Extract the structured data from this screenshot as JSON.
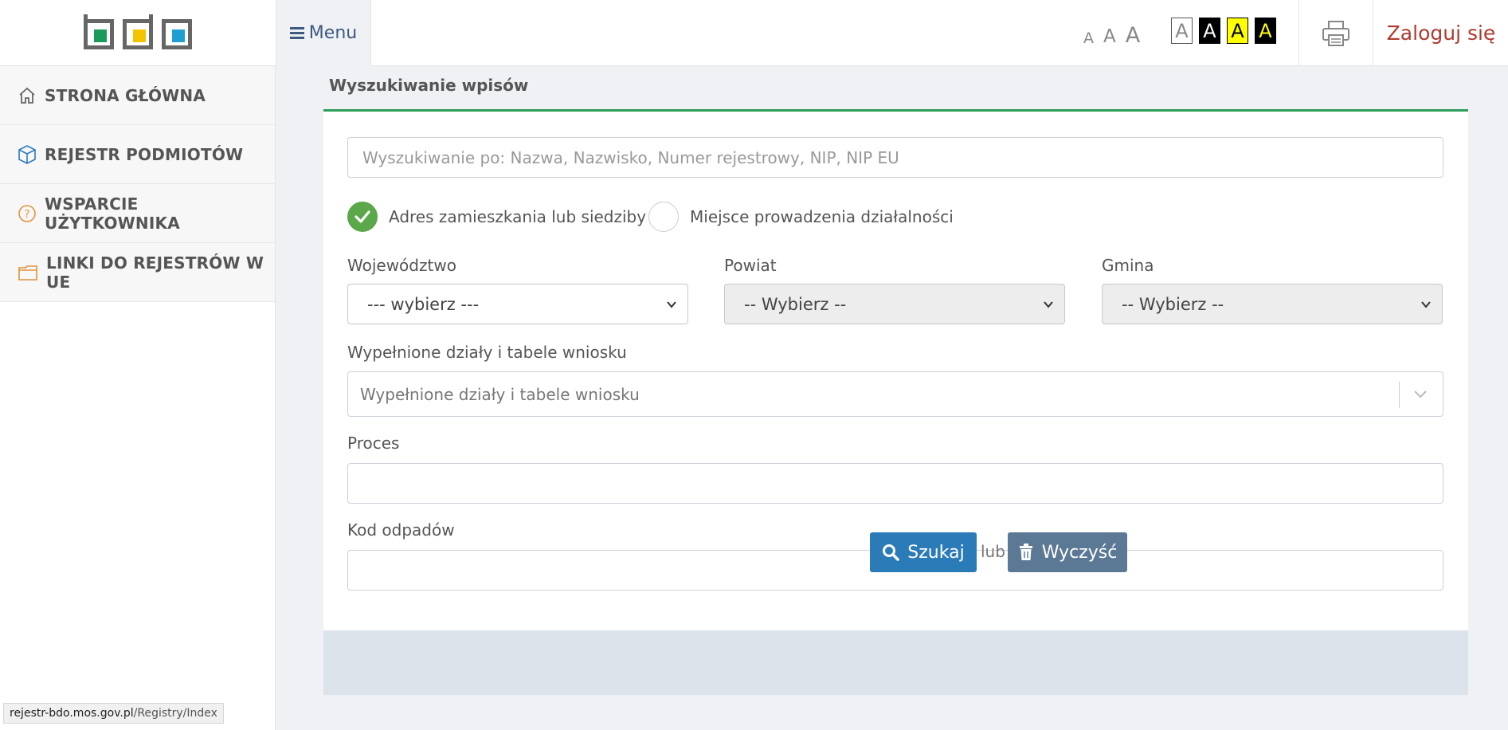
{
  "header": {
    "menu_label": "Menu",
    "font_size_small": "A",
    "font_size_medium": "A",
    "font_size_large": "A",
    "contrast_options": [
      {
        "label": "A",
        "bg": "#ffffff",
        "fg": "#888888",
        "border": "#555555"
      },
      {
        "label": "A",
        "bg": "#000000",
        "fg": "#ffffff",
        "border": "#000000"
      },
      {
        "label": "A",
        "bg": "#ffff00",
        "fg": "#000000",
        "border": "#000000"
      },
      {
        "label": "A",
        "bg": "#000000",
        "fg": "#ffff00",
        "border": "#000000"
      }
    ],
    "login_label": "Zaloguj się"
  },
  "logo": {
    "colors": [
      "#1a9b5a",
      "#f5c400",
      "#1d9fd1"
    ]
  },
  "sidebar": {
    "items": [
      {
        "label": "STRONA GŁÓWNA",
        "icon": "home-icon"
      },
      {
        "label": "REJESTR PODMIOTÓW",
        "icon": "cube-icon"
      },
      {
        "label": "WSPARCIE UŻYTKOWNIKA",
        "icon": "question-icon"
      },
      {
        "label": "LINKI DO REJESTRÓW W UE",
        "icon": "folder-icon"
      }
    ]
  },
  "main": {
    "section_title": "Wyszukiwanie wpisów",
    "search": {
      "placeholder": "Wyszukiwanie po: Nazwa, Nazwisko, Numer rejestrowy, NIP, NIP EU",
      "value": ""
    },
    "address_type": {
      "options": [
        "Adres zamieszkania lub siedziby",
        "Miejsce prowadzenia działalności"
      ],
      "selected": "Adres zamieszkania lub siedziby"
    },
    "wojewodztwo": {
      "label": "Województwo",
      "value": "--- wybierz ---"
    },
    "powiat": {
      "label": "Powiat",
      "value": "-- Wybierz --"
    },
    "gmina": {
      "label": "Gmina",
      "value": "-- Wybierz --"
    },
    "dzialy": {
      "label": "Wypełnione działy i tabele wniosku",
      "placeholder": "Wypełnione działy i tabele wniosku"
    },
    "proces": {
      "label": "Proces",
      "value": ""
    },
    "kod_odpadow": {
      "label": "Kod odpadów",
      "value": ""
    },
    "actions": {
      "search_label": "Szukaj",
      "or_label": "lub",
      "clear_label": "Wyczyść"
    }
  },
  "statusbar": {
    "url_host": "rejestr-bdo.mos.gov.pl",
    "url_path": "/Registry/Index"
  },
  "colors": {
    "accent_green": "#2e9e5b",
    "radio_checked": "#5aa84a",
    "search_button": "#2b7bb9",
    "clear_button": "#5b7894",
    "login_text": "#b03a2e"
  }
}
